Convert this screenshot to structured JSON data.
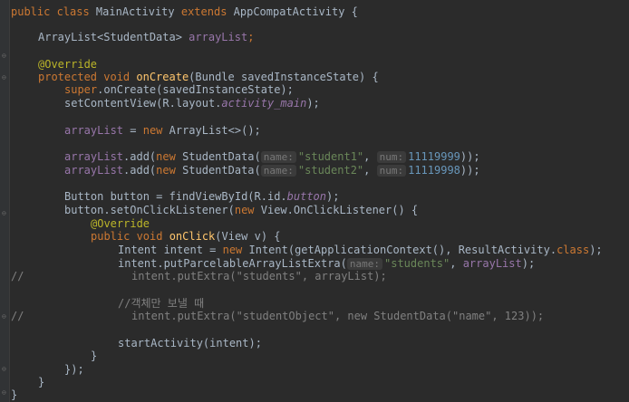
{
  "colors": {
    "background": "#2b2b2b",
    "keyword": "#cc7832",
    "method": "#ffc66d",
    "field": "#9876aa",
    "string": "#6a8759",
    "number": "#6897bb",
    "annotation": "#bbb529",
    "comment": "#808080",
    "text": "#a9b7c6"
  },
  "code": {
    "l1": {
      "kw": "public class ",
      "name": "MainActivity ",
      "kw2": "extends ",
      "base": "AppCompatActivity {"
    },
    "l3": {
      "type": "ArrayList<StudentData> ",
      "field": "arrayList",
      "end": ";"
    },
    "l5": {
      "ann": "@Override"
    },
    "l6": {
      "kw": "protected void ",
      "fn": "onCreate",
      "rest": "(Bundle savedInstanceState) {"
    },
    "l7": {
      "kw": "super",
      "rest": ".onCreate(savedInstanceState);"
    },
    "l8": {
      "rest": "setContentView(R.layout.",
      "ifield": "activity_main",
      "end": ");"
    },
    "l10": {
      "field": "arrayList",
      "mid": " = ",
      "kw": "new ",
      "rest": "ArrayList<>();"
    },
    "l12": {
      "field": "arrayList",
      "a": ".add(",
      "kw": "new ",
      "b": "StudentData(",
      "hint1": "name:",
      "str": "\"student1\"",
      "c": ", ",
      "hint2": "num:",
      "num": "11119999",
      "end": "));"
    },
    "l13": {
      "field": "arrayList",
      "a": ".add(",
      "kw": "new ",
      "b": "StudentData(",
      "hint1": "name:",
      "str": "\"student2\"",
      "c": ", ",
      "hint2": "num:",
      "num": "11119998",
      "end": "));"
    },
    "l15": {
      "rest": "Button button = findViewById(R.id.",
      "ifield": "button",
      "end": ");"
    },
    "l16": {
      "a": "button.setOnClickListener(",
      "kw": "new ",
      "b": "View.OnClickListener() {"
    },
    "l17": {
      "ann": "@Override"
    },
    "l18": {
      "kw": "public void ",
      "fn": "onClick",
      "rest": "(View v) {"
    },
    "l19": {
      "a": "Intent intent = ",
      "kw": "new ",
      "b": "Intent(getApplicationContext(), ResultActivity.",
      "kw2": "class",
      "end": ");"
    },
    "l20": {
      "a": "intent.putParcelableArrayListExtra(",
      "hint": "name:",
      "str": "\"students\"",
      "b": ", ",
      "field": "arrayList",
      "end": ");"
    },
    "l21": {
      "marker": "//",
      "text": "intent.putExtra(\"students\", arrayList);"
    },
    "l23": {
      "text": "//객체만 보낼 때"
    },
    "l24": {
      "marker": "//",
      "text": "intent.putExtra(\"studentObject\", new StudentData(\"name\", 123));"
    },
    "l26": {
      "text": "startActivity(intent);"
    },
    "l27": {
      "text": "}"
    },
    "l28": {
      "text": "});"
    },
    "l29": {
      "text": "}"
    },
    "l30": {
      "text": "}"
    }
  }
}
